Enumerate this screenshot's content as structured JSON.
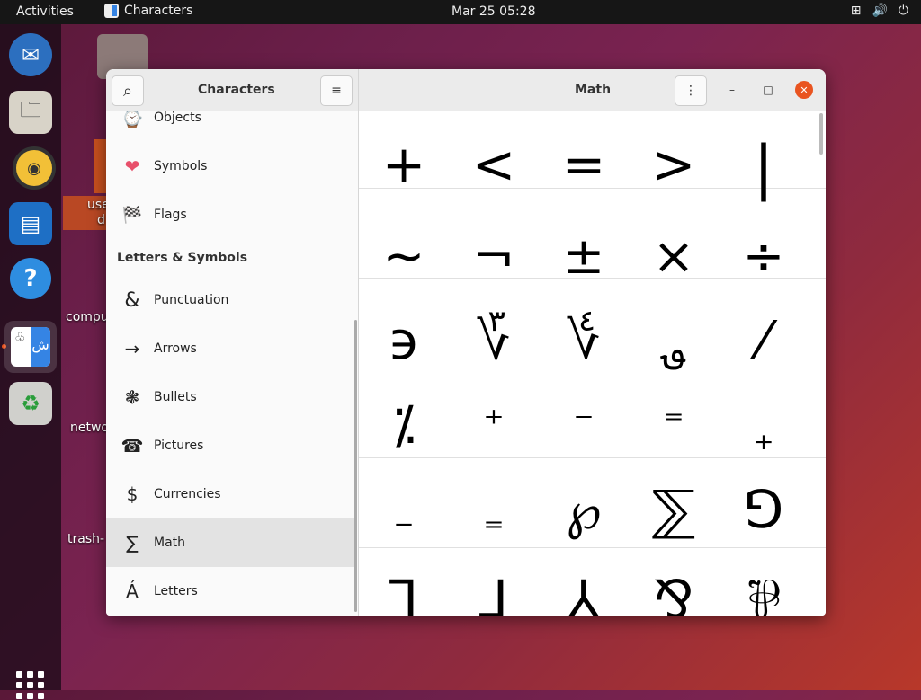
{
  "topbar": {
    "activities": "Activities",
    "app_name": "Characters",
    "clock": "Mar 25  05:28",
    "network_icon": "⊞",
    "volume_icon": "🔊",
    "power_icon": "⏻"
  },
  "dock": {
    "items": [
      {
        "name": "thunderbird",
        "icon": "✉"
      },
      {
        "name": "files",
        "icon": "🗀"
      },
      {
        "name": "rhythmbox",
        "icon": "◉"
      },
      {
        "name": "libreoffice-writer",
        "icon": "▤"
      },
      {
        "name": "help",
        "icon": "?"
      },
      {
        "name": "characters",
        "icon": "ش"
      },
      {
        "name": "trash",
        "icon": "♻"
      }
    ]
  },
  "desktop": {
    "labels": [
      "use",
      "d",
      "compu",
      "netwo",
      "trash-"
    ]
  },
  "window": {
    "sidebar_title": "Characters",
    "main_title": "Math",
    "search_icon": "⌕",
    "menu_icon": "≡",
    "more_icon": "⋮",
    "minimize_icon": "–",
    "maximize_icon": "□",
    "close_icon": "✕"
  },
  "sidebar": {
    "items_top": [
      {
        "label": "Objects",
        "icon": "⌚"
      },
      {
        "label": "Symbols",
        "icon": "❤"
      },
      {
        "label": "Flags",
        "icon": "🏁"
      }
    ],
    "section_header": "Letters & Symbols",
    "items": [
      {
        "label": "Punctuation",
        "icon": "&"
      },
      {
        "label": "Arrows",
        "icon": "→"
      },
      {
        "label": "Bullets",
        "icon": "❃"
      },
      {
        "label": "Pictures",
        "icon": "☎"
      },
      {
        "label": "Currencies",
        "icon": "$"
      },
      {
        "label": "Math",
        "icon": "∑"
      },
      {
        "label": "Letters",
        "icon": "Á"
      }
    ]
  },
  "characters": [
    [
      "+",
      "<",
      "=",
      ">",
      "|"
    ],
    [
      "∼",
      "¬",
      "±",
      "×",
      "÷"
    ],
    [
      "϶",
      "؆",
      "؇",
      "؈",
      "⁄"
    ],
    [
      "⁒",
      "⁺",
      "⁻",
      "⁼",
      "₊"
    ],
    [
      "₋",
      "₌",
      "℘",
      "⅀",
      "⅁"
    ],
    [
      "⅂",
      "⅃",
      "⅄",
      "⅋",
      "⅌"
    ]
  ],
  "colors": {
    "accent": "#e95420",
    "selected_bg": "#e3e3e3"
  }
}
